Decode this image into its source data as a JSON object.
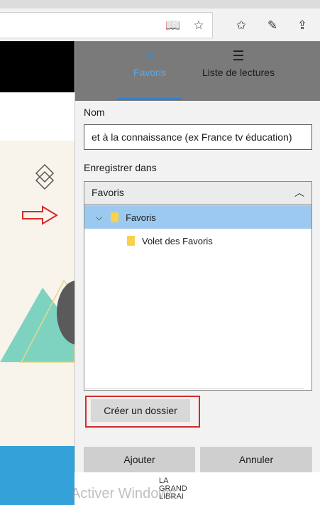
{
  "toolbar": {
    "icons": [
      "reading-view-icon",
      "star-icon",
      "favorites-list-icon",
      "pen-icon",
      "share-icon"
    ]
  },
  "panel": {
    "tabs": [
      {
        "label": "Favoris",
        "icon": "star-icon",
        "active": true
      },
      {
        "label": "Liste de lectures",
        "icon": "reading-list-icon",
        "active": false
      }
    ],
    "name_label": "Nom",
    "name_value": "et à la connaissance (ex France tv éducation)",
    "save_in_label": "Enregistrer dans",
    "save_in_selected": "Favoris",
    "folders": [
      {
        "label": "Favoris",
        "level": 0,
        "expanded": true,
        "selected": true
      },
      {
        "label": "Volet des Favoris",
        "level": 1,
        "expanded": false,
        "selected": false
      }
    ],
    "create_folder_label": "Créer un dossier",
    "add_label": "Ajouter",
    "cancel_label": "Annuler"
  },
  "overlay": {
    "watermark": "Activer Windows",
    "brand_lines": [
      "LA",
      "GRAND",
      "LIBRAI"
    ]
  },
  "colors": {
    "accent": "#3b8fd6",
    "selection": "#9cc9ef",
    "highlight_box": "#d42a2a",
    "folder": "#f9d14a"
  }
}
